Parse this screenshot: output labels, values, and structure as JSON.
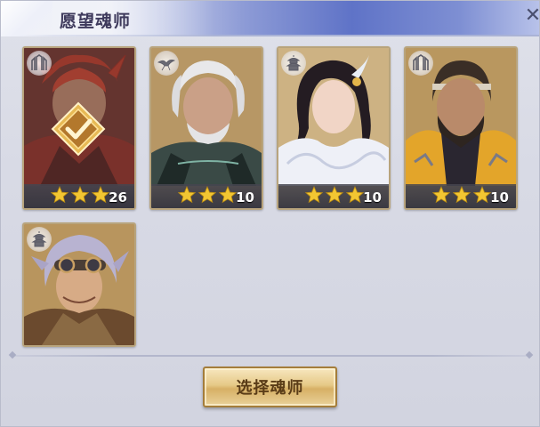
{
  "header": {
    "title": "愿望魂师",
    "close_icon": "close-icon"
  },
  "cards": [
    {
      "level": "26",
      "stars": 3,
      "selected": true,
      "class_icon": "tower-icon",
      "portrait": "red-haired-warrior"
    },
    {
      "level": "10",
      "stars": 3,
      "selected": false,
      "class_icon": "bird-icon",
      "portrait": "silver-haired-elder"
    },
    {
      "level": "10",
      "stars": 3,
      "selected": false,
      "class_icon": "pagoda-icon",
      "portrait": "dark-haired-lady"
    },
    {
      "level": "10",
      "stars": 3,
      "selected": false,
      "class_icon": "tower-icon",
      "portrait": "bearded-warrior"
    },
    {
      "level": "",
      "stars": 0,
      "selected": false,
      "class_icon": "pagoda-icon",
      "portrait": "goggles-youth"
    }
  ],
  "footer": {
    "select_label": "选择魂师"
  },
  "colors": {
    "accent_gold": "#e6c987",
    "star_gold": "#f2c632",
    "header_blue": "#5f73c7",
    "card_border": "#b8a47d"
  }
}
